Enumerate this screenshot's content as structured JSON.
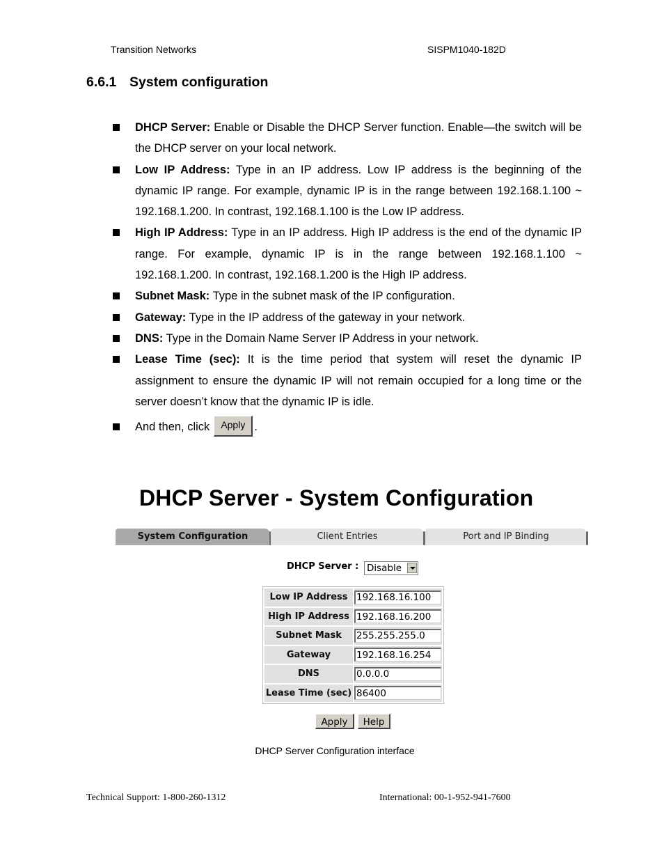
{
  "header": {
    "left": "Transition Networks",
    "right": "SISPM1040-182D"
  },
  "section": {
    "number": "6.6.1",
    "title": "System configuration"
  },
  "bullets": [
    {
      "term": "DHCP Server:",
      "text": " Enable or Disable the DHCP Server function. Enable—the switch will be the DHCP server on your local network."
    },
    {
      "term": "Low IP Address:",
      "text": " Type in an IP address. Low IP address is the beginning of the dynamic IP range. For example, dynamic IP is in the range between 192.168.1.100 ~ 192.168.1.200. In contrast, 192.168.1.100 is the Low IP address."
    },
    {
      "term": "High IP Address:",
      "text": " Type in an IP address. High IP address is the end of the dynamic IP range. For example, dynamic IP is in the range between 192.168.1.100 ~ 192.168.1.200. In contrast, 192.168.1.200 is the High IP address."
    },
    {
      "term": "Subnet Mask:",
      "text": " Type in the subnet mask of the IP configuration."
    },
    {
      "term": "Gateway:",
      "text": " Type in the IP address of the gateway in your network."
    },
    {
      "term": "DNS:",
      "text": " Type in the Domain Name Server IP Address in your network."
    },
    {
      "term": "Lease Time (sec):",
      "text": " It is the time period that system will reset the dynamic IP assignment to ensure the dynamic IP will not remain occupied for a long time or the server doesn’t know that the dynamic IP is idle."
    }
  ],
  "final_step": {
    "prefix": "And then, click",
    "button_label": "Apply",
    "suffix": "."
  },
  "screenshot": {
    "title": "DHCP Server - System Configuration",
    "tabs": [
      {
        "label": "System Configuration",
        "active": true
      },
      {
        "label": "Client Entries",
        "active": false
      },
      {
        "label": "Port and IP Binding",
        "active": false
      }
    ],
    "dhcp_server_label": "DHCP Server :",
    "dhcp_server_value": "Disable",
    "fields": [
      {
        "label": "Low IP Address",
        "value": "192.168.16.100"
      },
      {
        "label": "High IP Address",
        "value": "192.168.16.200"
      },
      {
        "label": "Subnet Mask",
        "value": "255.255.255.0"
      },
      {
        "label": "Gateway",
        "value": "192.168.16.254"
      },
      {
        "label": "DNS",
        "value": "0.0.0.0"
      },
      {
        "label": "Lease Time (sec)",
        "value": "86400"
      }
    ],
    "apply_label": "Apply",
    "help_label": "Help",
    "colors": {
      "active_tab": "#a9a9a9",
      "inactive_tab": "#e3e3e3",
      "label_cell": "#e0e0e0",
      "button_face": "#d4d0c8"
    }
  },
  "caption": "DHCP Server Configuration interface",
  "footer": {
    "left": "Technical Support: 1-800-260-1312",
    "right": "International: 00-1-952-941-7600"
  }
}
